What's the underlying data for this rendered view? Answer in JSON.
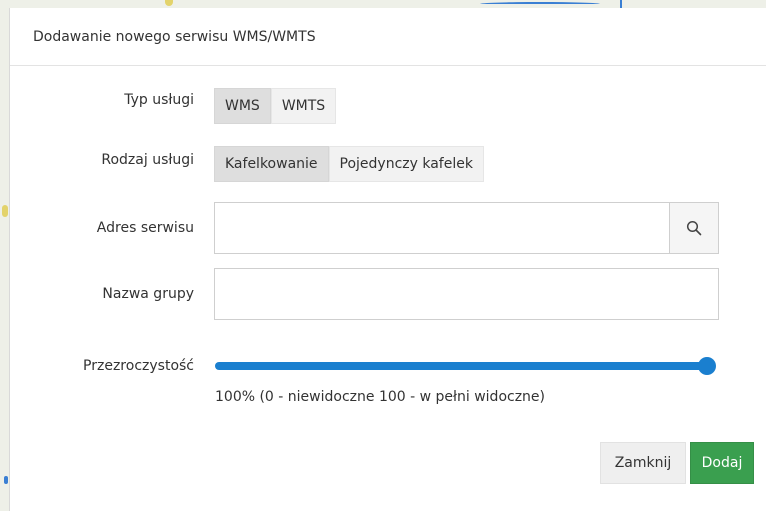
{
  "modal": {
    "title": "Dodawanie nowego serwisu WMS/WMTS"
  },
  "form": {
    "service_type": {
      "label": "Typ usługi",
      "options": [
        "WMS",
        "WMTS"
      ],
      "selected": "WMS"
    },
    "service_kind": {
      "label": "Rodzaj usługi",
      "options": [
        "Kafelkowanie",
        "Pojedynczy kafelek"
      ],
      "selected": "Kafelkowanie"
    },
    "service_address": {
      "label": "Adres serwisu",
      "value": "",
      "placeholder": ""
    },
    "group_name": {
      "label": "Nazwa grupy",
      "value": "",
      "placeholder": ""
    },
    "opacity": {
      "label": "Przezroczystość",
      "value_percent": 100,
      "note": "100% (0 - niewidoczne 100 - w pełni widoczne)"
    }
  },
  "footer": {
    "close_label": "Zamknij",
    "add_label": "Dodaj"
  },
  "colors": {
    "slider": "#1a7fcf",
    "add_button": "#3a9f4f",
    "segment_active": "#dedede"
  },
  "icons": {
    "search": "search-icon"
  }
}
